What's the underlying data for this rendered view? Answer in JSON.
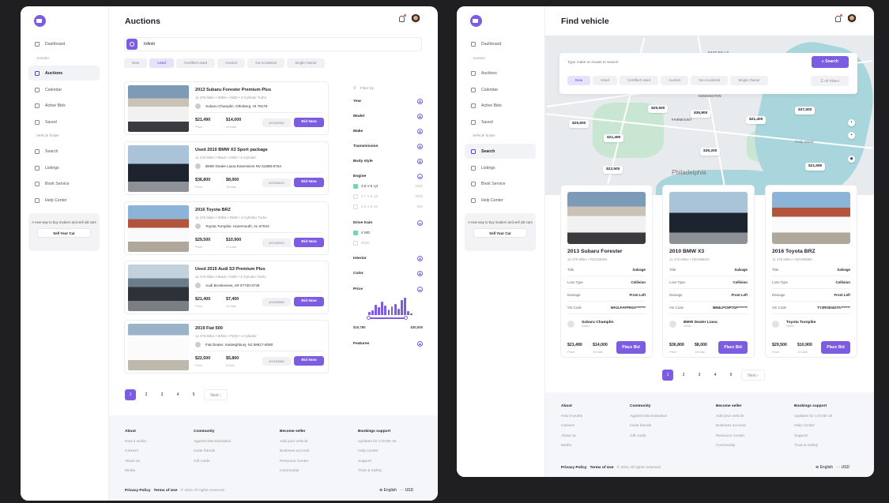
{
  "sidebar": {
    "items": [
      "Dashboard",
      "Auctions",
      "Calendar",
      "Active Bids",
      "Saved",
      "Search",
      "Listings",
      "Book Service",
      "Help Center"
    ],
    "sections": [
      "Auction",
      "Vehicle finder"
    ],
    "promo_text": "A new way to buy modern and sell old cars",
    "promo_button": "Sell Your Car"
  },
  "left": {
    "title": "Auctions",
    "search_value": "Infiniti",
    "tabs": [
      "New",
      "Used",
      "Certified Used",
      "Auction",
      "No Accidents",
      "Single Owner"
    ],
    "active_tab": "Used",
    "cars": [
      {
        "name": "2013 Subaru Forester Premium Plus",
        "spec": "11 475 Miles  •  White  •  AWD  •  4-Cylinder Turbo",
        "dealer": "Subaru Champlin, Othoberg, HI 78176",
        "price": "$21,490",
        "price_label": "Price",
        "bid": "$14,000",
        "bid_label": "10 bids",
        "lot": "#20189954",
        "button": "Bid Now"
      },
      {
        "name": "Used 2010 BMW X3 Sport package",
        "spec": "11 475 Miles  •  Black  •  AWD  •  4-Cylinder",
        "dealer": "BMW Dealer Liana Extensions NV 51888-8754",
        "price": "$36,800",
        "price_label": "Price",
        "bid": "$8,000",
        "bid_label": "18 bids",
        "lot": "#20189632",
        "button": "Bid Now"
      },
      {
        "name": "2016 Toyota BRZ",
        "spec": "11 475 Miles  •  White  •  RWD  •  4-Cylinder Turbo",
        "dealer": "Toyota Turnpike, Hanemouth, AL 57043",
        "price": "$29,500",
        "price_label": "Price",
        "bid": "$10,900",
        "bid_label": "12 bids",
        "lot": "#20189919",
        "button": "Bid Now"
      },
      {
        "name": "Used 2015 Audi S3 Premium Plus",
        "spec": "11 475 Miles  •  Black  •  AWD  •  4-Cylinder Turbo",
        "dealer": "Audi Brookeview, AR 07730-3728",
        "price": "$21,400",
        "price_label": "Price",
        "bid": "$7,400",
        "bid_label": "10 bids",
        "lot": "#20189885",
        "button": "Bid Now"
      },
      {
        "name": "2019 Fiat 500",
        "spec": "11 475 Miles  •  White  •  FWD  •  4-Cylinder",
        "dealer": "Fiat Dealer, Kasteighbury, NJ 58617-6080",
        "price": "$22,500",
        "price_label": "Price",
        "bid": "$5,800",
        "bid_label": "8 bids",
        "lot": "#20189880",
        "button": "Bid Now"
      }
    ],
    "filter_by": "Filter by",
    "filters": [
      "Year",
      "Model",
      "Make",
      "Transmission",
      "Body style",
      "Engine",
      "Drive train",
      "Interior",
      "Color",
      "Price",
      "Features"
    ],
    "engine_options": [
      {
        "label": "3.5 V-6 cyl",
        "count": "1500"
      },
      {
        "label": "3.7 V-6 cyl",
        "count": "3500"
      },
      {
        "label": "4.5 V-8 cyl",
        "count": "900"
      }
    ],
    "drive_options": [
      {
        "label": "4 WD"
      },
      {
        "label": "RWD"
      }
    ],
    "price_min": "$15,780",
    "price_max": "$30,000",
    "histogram": [
      0.15,
      0.25,
      0.55,
      0.4,
      0.7,
      0.5,
      0.3,
      0.45,
      0.6,
      0.35,
      0.8,
      0.9,
      0.2,
      0.1
    ],
    "pages": [
      "1",
      "2",
      "3",
      "4",
      "5"
    ],
    "next": "Next"
  },
  "right": {
    "title": "Find vehicle",
    "search_placeholder": "Type make or model to search",
    "search_button": "Search",
    "tabs": [
      "New",
      "Used",
      "Certified Used",
      "Auction",
      "No Accidents",
      "Single Owner"
    ],
    "all_filters": "All Filters",
    "map_labels": [
      "ALLEGHENY WEST",
      "EAST FALLS",
      "KENSINGTON",
      "FAIRMOUNT",
      "Philadelphia",
      "Petty Island"
    ],
    "pins": [
      "$29,500",
      "$36,800",
      "$21,400",
      "$29,500",
      "$21,490",
      "$39,200",
      "$22,500",
      "$37,500",
      "$21,690"
    ],
    "vehicles": [
      {
        "name": "2013 Subaru Forester",
        "spec": "11 475 Miles  •  #20189954",
        "title": "Salvage",
        "loss": "Collision",
        "damage": "Front Left",
        "vin": "WA1LFAFP9GA*******",
        "seller": "Subaru Champlin",
        "seller_role": "Seller",
        "price": "$21,490",
        "bid": "$14,000",
        "bids": "10 bids"
      },
      {
        "name": "2010 BMW X3",
        "spec": "11 475 Miles  •  #20189632",
        "title": "Salvage",
        "loss": "Collision",
        "damage": "Front Left",
        "vin": "BM4LPC9P7GF*******",
        "seller": "BMW Dealer Liana",
        "seller_role": "Seller",
        "price": "$36,800",
        "bid": "$8,000",
        "bids": "18 bids"
      },
      {
        "name": "2016 Toyota BRZ",
        "spec": "11 475 Miles  •  #20189880",
        "title": "Salvage",
        "loss": "Collision",
        "damage": "Front Left",
        "vin": "TY2R0304GTA*******",
        "seller": "Toyota Turnpike",
        "seller_role": "Seller",
        "price": "$29,500",
        "bid": "$10,900",
        "bids": "12 bids"
      }
    ],
    "row_labels": [
      "Title",
      "Loss Type",
      "Damage",
      "Vin Code"
    ],
    "price_label": "Price",
    "place_bid": "Place Bid"
  },
  "footer": {
    "columns": [
      {
        "head": "About",
        "links": [
          "How it works",
          "Careers",
          "About us",
          "Media"
        ]
      },
      {
        "head": "Community",
        "links": [
          "Against Discrimination",
          "Invite friends",
          "Gift cards"
        ]
      },
      {
        "head": "Become seller",
        "links": [
          "Add your vehicle",
          "Business account",
          "Resource Center",
          "Community"
        ]
      },
      {
        "head": "Bookings support",
        "links": [
          "Updates for COVID-19",
          "Help Center",
          "Support",
          "Trust & Safety"
        ]
      }
    ],
    "privacy": "Privacy Policy",
    "terms": "Terms of Use",
    "copyright": "© 2021 All rights reserved.",
    "language": "English",
    "currency": "USD"
  },
  "colors": {
    "accent": "#7c5ce0",
    "green": "#6fd8b7"
  }
}
